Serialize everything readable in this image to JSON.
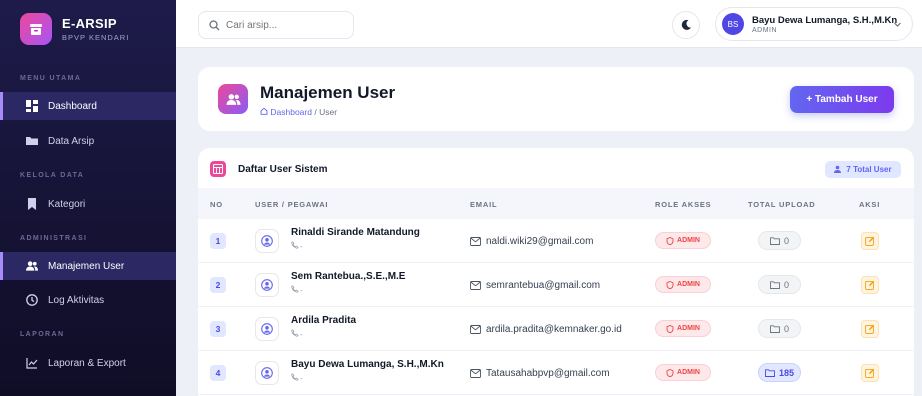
{
  "brand": {
    "title": "E-ARSIP",
    "subtitle": "BPVP KENDARI"
  },
  "sidebar": {
    "sections": [
      {
        "label": "MENU UTAMA"
      },
      {
        "label": "KELOLA DATA"
      },
      {
        "label": "ADMINISTRASI"
      },
      {
        "label": "LAPORAN"
      }
    ],
    "items": [
      {
        "label": "Dashboard",
        "icon": "dashboard-icon"
      },
      {
        "label": "Data Arsip",
        "icon": "folder-icon"
      },
      {
        "label": "Kategori",
        "icon": "bookmark-icon"
      },
      {
        "label": "Manajemen User",
        "icon": "users-icon"
      },
      {
        "label": "Log Aktivitas",
        "icon": "clock-icon"
      },
      {
        "label": "Laporan & Export",
        "icon": "chart-icon"
      }
    ]
  },
  "topbar": {
    "search_placeholder": "Cari arsip...",
    "user": {
      "initials": "BS",
      "name": "Bayu Dewa Lumanga, S.H.,M.Kn",
      "role": "ADMIN"
    }
  },
  "page": {
    "title": "Manajemen User",
    "breadcrumb_home": "Dashboard",
    "breadcrumb_sep": "/",
    "breadcrumb_current": "User",
    "add_button": "+ Tambah User"
  },
  "table": {
    "title": "Daftar User Sistem",
    "total_badge": "7 Total User",
    "columns": [
      "NO",
      "USER / PEGAWAI",
      "EMAIL",
      "ROLE AKSES",
      "TOTAL UPLOAD",
      "AKSI"
    ],
    "rows": [
      {
        "no": "1",
        "name": "Rinaldi Sirande Matandung",
        "phone": "-",
        "email": "naldi.wiki29@gmail.com",
        "role": "ADMIN",
        "uploads": "0"
      },
      {
        "no": "2",
        "name": "Sem Rantebua.,S.E.,M.E",
        "phone": "-",
        "email": "semrantebua@gmail.com",
        "role": "ADMIN",
        "uploads": "0"
      },
      {
        "no": "3",
        "name": "Ardila Pradita",
        "phone": "-",
        "email": "ardila.pradita@kemnaker.go.id",
        "role": "ADMIN",
        "uploads": "0"
      },
      {
        "no": "4",
        "name": "Bayu Dewa Lumanga, S.H.,M.Kn",
        "phone": "-",
        "email": "Tatausahabpvp@gmail.com",
        "role": "ADMIN",
        "uploads": "185"
      }
    ]
  },
  "colors": {
    "accent": "#6366f1",
    "sidebar": "#1e1b4b",
    "danger": "#ef4444",
    "brand_pink": "#ec4899"
  }
}
